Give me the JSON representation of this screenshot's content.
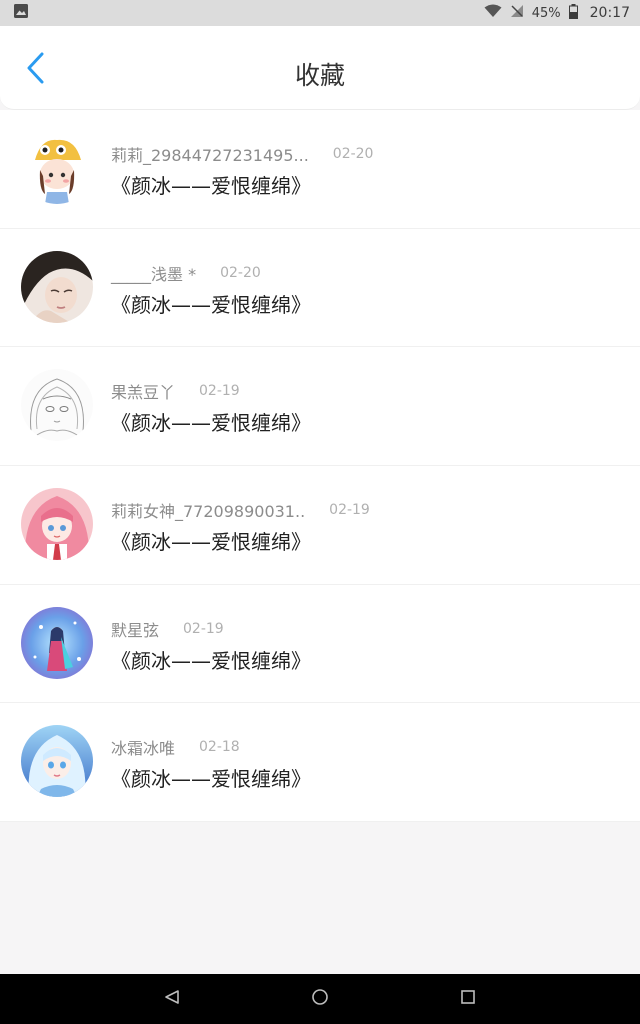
{
  "status_bar": {
    "battery": "45%",
    "time": "20:17"
  },
  "header": {
    "title": "收藏"
  },
  "favorites": [
    {
      "username": "莉莉_29844727231495...",
      "date": "02-20",
      "work": "《颜冰——爱恨缠绵》"
    },
    {
      "username": "_____浅墨 *",
      "date": "02-20",
      "work": "《颜冰——爱恨缠绵》"
    },
    {
      "username": "果羔豆丫",
      "date": "02-19",
      "work": "《颜冰——爱恨缠绵》"
    },
    {
      "username": "莉莉女神_77209890031..",
      "date": "02-19",
      "work": "《颜冰——爱恨缠绵》"
    },
    {
      "username": "默星弦",
      "date": "02-19",
      "work": "《颜冰——爱恨缠绵》"
    },
    {
      "username": "冰霜冰唯",
      "date": "02-18",
      "work": "《颜冰——爱恨缠绵》"
    }
  ],
  "colors": {
    "accent": "#2a9bf0",
    "status_bar_bg": "#dcdcdc",
    "page_bg": "#f6f5f6"
  },
  "icons": {
    "back": "chevron-left-icon",
    "nav_back": "triangle-back-icon",
    "nav_home": "circle-home-icon",
    "nav_recent": "square-recent-icon"
  }
}
